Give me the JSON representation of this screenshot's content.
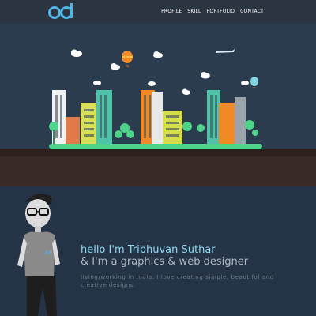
{
  "header": {
    "logo_text": "ad",
    "nav": [
      {
        "label": "PROFILE"
      },
      {
        "label": "SKILL"
      },
      {
        "label": "PORTFOLIO"
      },
      {
        "label": "CONTACT"
      }
    ]
  },
  "intro": {
    "greeting": "hello I'm Tribhuvan Suthar",
    "role": "& I'm a graphics & web designer",
    "description": "living/working in India. I love creating simple, beautiful and creative designs."
  },
  "colors": {
    "accent": "#8ed8f0",
    "navbar": "#2b3542",
    "background": "#243446"
  }
}
